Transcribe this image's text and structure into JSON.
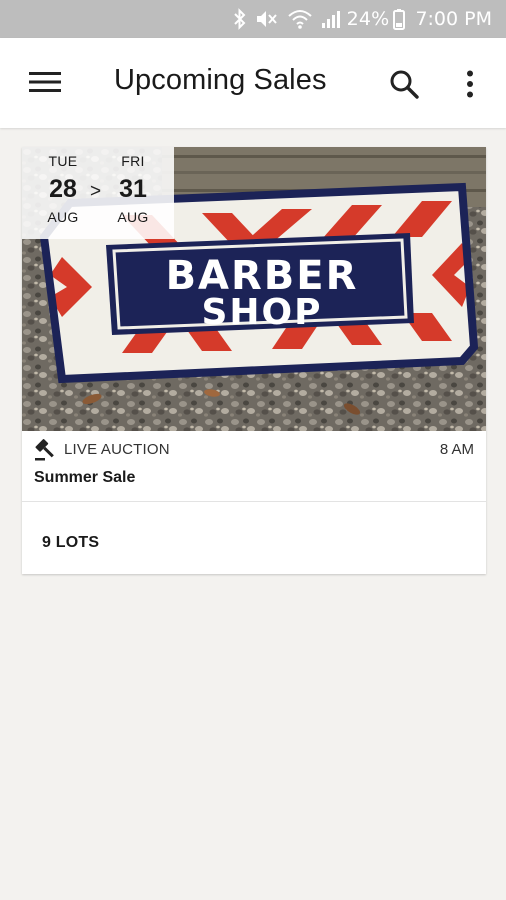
{
  "status_bar": {
    "battery": "24%",
    "time": "7:00 PM",
    "icons": [
      "bluetooth-icon",
      "mute-icon",
      "wifi-icon",
      "signal-icon",
      "battery-icon"
    ]
  },
  "app_bar": {
    "title": "Upcoming Sales",
    "icons": [
      "menu-icon",
      "search-icon",
      "more-vert-icon"
    ]
  },
  "sales": [
    {
      "image": {
        "description_icon": "barber-shop-sign-photo",
        "sign_line1": "BARBER",
        "sign_line2": "SHOP"
      },
      "start": {
        "dow": "TUE",
        "day": "28",
        "month": "AUG"
      },
      "separator": ">",
      "end": {
        "dow": "FRI",
        "day": "31",
        "month": "AUG"
      },
      "type_icon": "gavel-icon",
      "type": "LIVE AUCTION",
      "time": "8 AM",
      "name": "Summer Sale",
      "lots": "9 LOTS"
    }
  ],
  "colors": {
    "status_bar": "#bdbdbd",
    "background": "#f3f2ef",
    "sign_navy": "#1c2357",
    "sign_red": "#d53a2a"
  }
}
